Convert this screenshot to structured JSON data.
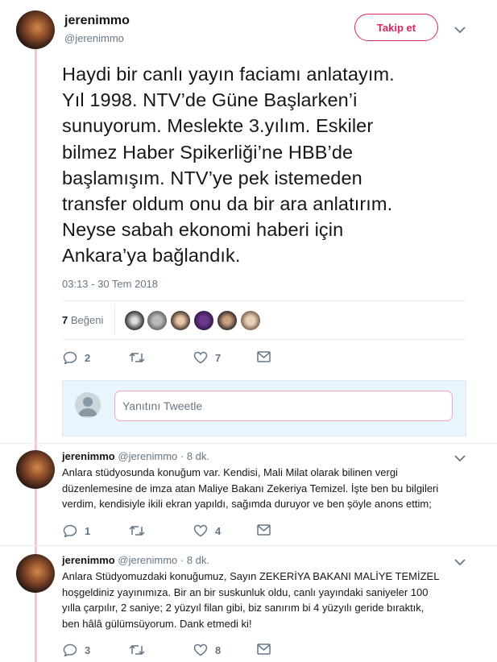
{
  "main_tweet": {
    "display_name": "jerenimmo",
    "handle": "@jerenimmo",
    "follow_label": "Takip et",
    "text": "Haydi bir canlı yayın faciamı anlatayım.\nYıl 1998. NTV’de Güne Başlarken’i\nsunuyorum. Meslekte 3.yılım. Eskiler\nbilmez Haber Spikerliği’ne HBB’de\nbaşlamışım. NTV’ye pek istemeden\ntransfer oldum onu da bir ara anlatırım.\nNeyse sabah ekonomi haberi için\nAnkara’ya bağlandık.",
    "timestamp": "03:13 - 30 Tem 2018",
    "likes": {
      "count": "7",
      "label": "Beğeni"
    },
    "actions": {
      "replies": "2",
      "retweets": "",
      "likes": "7"
    }
  },
  "reply_box": {
    "placeholder": "Yanıtını Tweetle"
  },
  "replies": [
    {
      "display_name": "jerenimmo",
      "handle": "@jerenimmo",
      "time": "· 8 dk.",
      "text": "Anlara stüdyosunda konuğum var. Kendisi, Mali Milat olarak bilinen vergi\ndüzenlemesine de imza atan Maliye Bakanı Zekeriya Temizel. İşte ben bu bilgileri\nverdim, kendisiyle ikili ekran yapıldı, sağımda duruyor ve ben şöyle anons ettim;",
      "actions": {
        "replies": "1",
        "retweets": "",
        "likes": "4"
      }
    },
    {
      "display_name": "jerenimmo",
      "handle": "@jerenimmo",
      "time": "· 8 dk.",
      "text": "Anlara Stüdyomuzdaki konuğumuz, Sayın ZEKERİYA BAKANI MALİYE TEMİZEL\nhoşgeldiniz yayınımıza. Bir an bir suskunluk oldu, canlı yayındaki saniyeler 100\nyılla çarpılır, 2 saniye;  2 yüzyıl filan gibi, biz sanırım bi 4 yüzyılı geride bıraktık,\nben hâlâ gülümsüyorum. Dank etmedi ki!",
      "actions": {
        "replies": "3",
        "retweets": "",
        "likes": "8"
      }
    }
  ],
  "colors": {
    "accent": "#e0245e",
    "thread_line": "#f5c7cc",
    "muted": "#657786",
    "reply_bg": "#e8f5fd"
  }
}
